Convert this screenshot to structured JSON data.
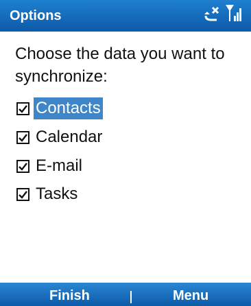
{
  "title_bar": {
    "title": "Options",
    "icons": [
      "sync-error-icon",
      "signal-strength-icon"
    ]
  },
  "prompt": "Choose the data you want to synchronize:",
  "options": [
    {
      "label": "Contacts",
      "checked": true,
      "selected": true
    },
    {
      "label": "Calendar",
      "checked": true,
      "selected": false
    },
    {
      "label": "E-mail",
      "checked": true,
      "selected": false
    },
    {
      "label": "Tasks",
      "checked": true,
      "selected": false
    }
  ],
  "softkeys": {
    "left": "Finish",
    "right": "Menu"
  },
  "colors": {
    "bar": "#1f7fd0",
    "highlight": "#3f86c9"
  }
}
